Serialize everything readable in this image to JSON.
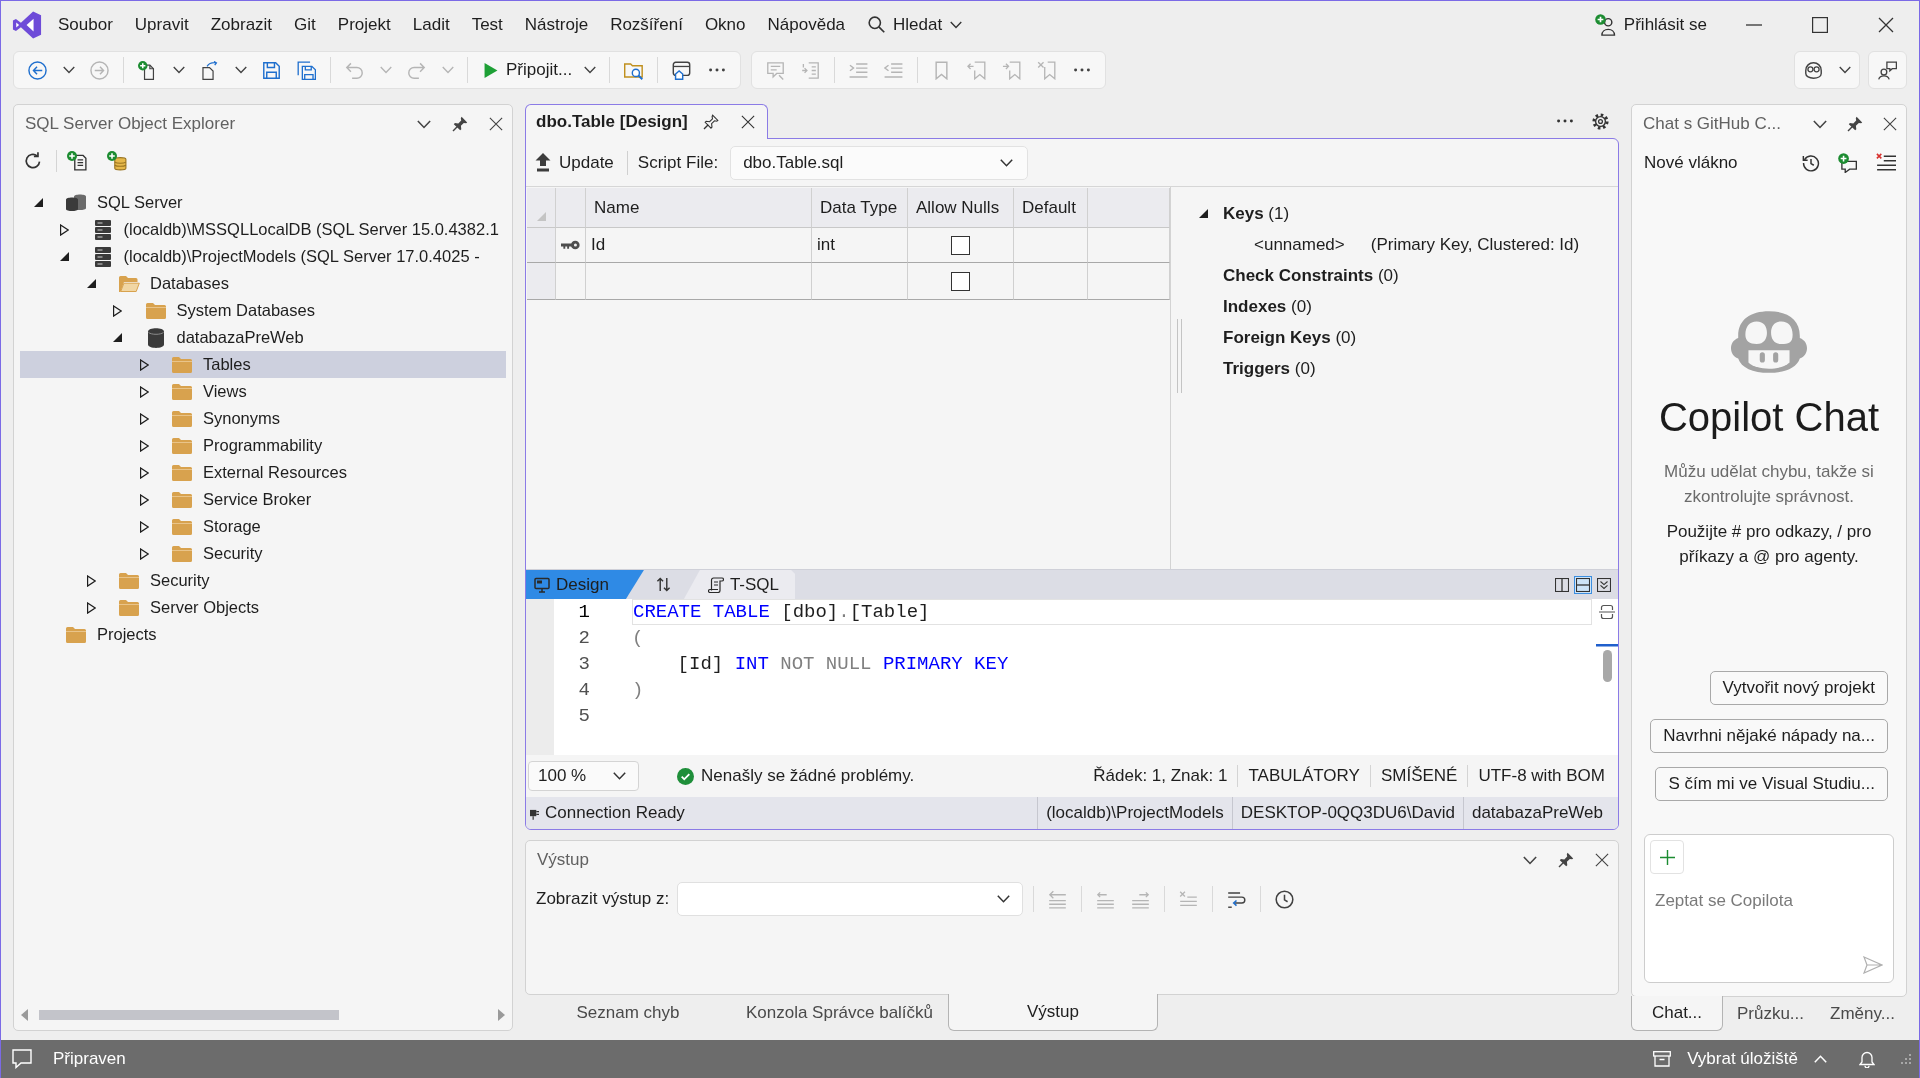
{
  "title_bar": {
    "menu": [
      {
        "label": "Soubor"
      },
      {
        "label": "Upravit"
      },
      {
        "label": "Zobrazit"
      },
      {
        "label": "Git"
      },
      {
        "label": "Projekt"
      },
      {
        "label": "Ladit"
      },
      {
        "label": "Test"
      },
      {
        "label": "Nástroje"
      },
      {
        "label": "Rozšíření"
      },
      {
        "label": "Okno"
      },
      {
        "label": "Nápověda"
      }
    ],
    "search": "Hledat",
    "sign_in": "Přihlásit se"
  },
  "toolbar": {
    "left": [
      [
        [
          {
            "kind": "back",
            "disabled": false
          },
          {
            "kind": "dropdown",
            "disabled": false
          },
          {
            "kind": "forward",
            "disabled": true
          }
        ],
        [
          {
            "kind": "new-item",
            "disabled": false
          },
          {
            "kind": "dropdown",
            "disabled": false
          },
          {
            "kind": "open-file",
            "disabled": false
          },
          {
            "kind": "dropdown",
            "disabled": false
          },
          {
            "kind": "save",
            "disabled": false
          },
          {
            "kind": "save-all",
            "disabled": false
          }
        ],
        [
          {
            "kind": "undo",
            "disabled": true
          },
          {
            "kind": "dropdown",
            "disabled": true
          },
          {
            "kind": "redo",
            "disabled": true
          },
          {
            "kind": "dropdown",
            "disabled": true
          }
        ],
        [
          {
            "kind": "start",
            "label": "Připojit...",
            "disabled": false
          },
          {
            "kind": "dropdown",
            "disabled": false
          }
        ],
        [
          {
            "kind": "find-in-files",
            "disabled": false
          }
        ],
        [
          {
            "kind": "browser",
            "disabled": false
          },
          {
            "kind": "more",
            "disabled": false
          }
        ]
      ],
      [
        [
          {
            "kind": "comment",
            "disabled": true
          },
          {
            "kind": "uncomment",
            "disabled": true
          }
        ],
        [
          {
            "kind": "indent",
            "disabled": true
          },
          {
            "kind": "outdent",
            "disabled": true
          }
        ],
        [
          {
            "kind": "bookmark",
            "disabled": true
          },
          {
            "kind": "bookmark-previous",
            "disabled": true
          },
          {
            "kind": "bookmark-next",
            "disabled": true
          },
          {
            "kind": "bookmark-clear",
            "disabled": true
          },
          {
            "kind": "more",
            "disabled": false
          }
        ]
      ]
    ],
    "right": [
      [
        [
          {
            "kind": "copilot",
            "disabled": false
          },
          {
            "kind": "dropdown",
            "disabled": false
          }
        ]
      ],
      [
        [
          {
            "kind": "feedback",
            "disabled": false
          }
        ]
      ]
    ]
  },
  "object_explorer": {
    "title": "SQL Server Object Explorer",
    "tree": [
      {
        "label": "SQL Server",
        "kind": "server-group",
        "expanded": true,
        "selected": false,
        "children": [
          {
            "label": "(localdb)\\MSSQLLocalDB (SQL Server 15.0.4382.1",
            "kind": "server",
            "expanded": false,
            "selected": false
          },
          {
            "label": "(localdb)\\ProjectModels (SQL Server 17.0.4025 -",
            "kind": "server",
            "expanded": true,
            "selected": false,
            "children": [
              {
                "label": "Databases",
                "kind": "folder-open",
                "expanded": true,
                "selected": false,
                "children": [
                  {
                    "label": "System Databases",
                    "kind": "folder",
                    "expanded": false,
                    "selected": false
                  },
                  {
                    "label": "databazaPreWeb",
                    "kind": "database",
                    "expanded": true,
                    "selected": false,
                    "children": [
                      {
                        "label": "Tables",
                        "kind": "folder",
                        "expanded": false,
                        "selected": true
                      },
                      {
                        "label": "Views",
                        "kind": "folder",
                        "expanded": false,
                        "selected": false
                      },
                      {
                        "label": "Synonyms",
                        "kind": "folder",
                        "expanded": false,
                        "selected": false
                      },
                      {
                        "label": "Programmability",
                        "kind": "folder",
                        "expanded": false,
                        "selected": false
                      },
                      {
                        "label": "External Resources",
                        "kind": "folder",
                        "expanded": false,
                        "selected": false
                      },
                      {
                        "label": "Service Broker",
                        "kind": "folder",
                        "expanded": false,
                        "selected": false
                      },
                      {
                        "label": "Storage",
                        "kind": "folder",
                        "expanded": false,
                        "selected": false
                      },
                      {
                        "label": "Security",
                        "kind": "folder",
                        "expanded": false,
                        "selected": false
                      }
                    ]
                  }
                ]
              },
              {
                "label": "Security",
                "kind": "folder",
                "expanded": false,
                "selected": false
              },
              {
                "label": "Server Objects",
                "kind": "folder",
                "expanded": false,
                "selected": false
              }
            ]
          }
        ]
      },
      {
        "label": "Projects",
        "kind": "folder",
        "selected": false
      }
    ]
  },
  "document": {
    "tabs": [
      {
        "title": "dbo.Table [Design]",
        "selected": true
      }
    ],
    "update": "Update",
    "script_file": {
      "label": "Script File:",
      "value": "dbo.Table.sql"
    },
    "grid": {
      "columns": [
        "Name",
        "Data Type",
        "Allow Nulls",
        "Default"
      ],
      "rows": [
        {
          "primary_key": true,
          "name": "Id",
          "data_type": "int",
          "allow_nulls": false
        },
        {
          "primary_key": false,
          "allow_nulls": false
        }
      ]
    },
    "properties": [
      {
        "text": "**Keys** (1)",
        "expanded": true,
        "children": [
          {
            "name": "<unnamed>",
            "detail": "(Primary Key, Clustered: Id)"
          }
        ]
      },
      {
        "text": "**Check Constraints** (0)"
      },
      {
        "text": "**Indexes** (0)"
      },
      {
        "text": "**Foreign Keys** (0)"
      },
      {
        "text": "**Triggers** (0)"
      }
    ],
    "view_tabs": [
      {
        "label": "Design",
        "kind": "design",
        "selected": true
      },
      {
        "label": "T-SQL",
        "kind": "script",
        "selected": false
      }
    ],
    "layout_buttons": [
      {
        "kind": "vertical",
        "selected": false
      },
      {
        "kind": "horizontal",
        "selected": true
      },
      {
        "kind": "collapse",
        "selected": false
      }
    ],
    "code": {
      "lines": [
        {
          "number": "1",
          "current": true,
          "tokens": [
            {
              "text": "CREATE TABLE",
              "kind": "keyword"
            },
            {
              "text": " [dbo]",
              "kind": "plain"
            },
            {
              "text": ".",
              "kind": "operator"
            },
            {
              "text": "[Table]",
              "kind": "plain"
            }
          ]
        },
        {
          "number": "2",
          "current": false,
          "tokens": [
            {
              "text": "(",
              "kind": "operator"
            }
          ]
        },
        {
          "number": "3",
          "current": false,
          "tokens": [
            {
              "text": "    [Id] ",
              "kind": "plain"
            },
            {
              "text": "INT",
              "kind": "keyword"
            },
            {
              "text": " NOT NULL ",
              "kind": "operator"
            },
            {
              "text": "PRIMARY KEY",
              "kind": "keyword"
            }
          ]
        },
        {
          "number": "4",
          "current": false,
          "tokens": [
            {
              "text": ")",
              "kind": "operator"
            }
          ]
        },
        {
          "number": "5",
          "current": false
        }
      ]
    },
    "zoom": "100 %",
    "issues": "Nenašly se žádné problémy.",
    "status": [
      "Řádek: 1, Znak: 1",
      "TABULÁTORY",
      "SMÍŠENÉ",
      "UTF-8 with BOM"
    ],
    "connection": {
      "status": "Connection Ready",
      "details": [
        "(localdb)\\ProjectModels",
        "DESKTOP-0QQ3DU6\\David",
        "databazaPreWeb"
      ]
    }
  },
  "output": {
    "title": "Výstup",
    "source_label": "Zobrazit výstup z:",
    "toolbar": [
      [
        {
          "kind": "find-message",
          "disabled": true
        }
      ],
      [
        {
          "kind": "previous-message",
          "disabled": true
        },
        {
          "kind": "next-message",
          "disabled": true
        }
      ],
      [
        {
          "kind": "clear-all",
          "disabled": true
        }
      ],
      [
        {
          "kind": "word-wrap",
          "disabled": false
        }
      ],
      [
        {
          "kind": "timestamps",
          "disabled": false
        }
      ]
    ],
    "tabs": [
      {
        "label": "Seznam chyb",
        "selected": false
      },
      {
        "label": "Konzola Správce balíčků",
        "selected": false
      },
      {
        "label": "Výstup",
        "selected": true
      }
    ]
  },
  "copilot_chat": {
    "title": "Chat s GitHub C...",
    "thread": "Nové vlákno",
    "heading": "Copilot Chat",
    "disclaimer": "Můžu udělat chybu, takže si zkontrolujte správnost.",
    "hint": "Použijte # pro odkazy, / pro příkazy a @ pro agenty.",
    "suggestions": [
      "Vytvořit nový projekt",
      "Navrhni nějaké nápady na...",
      "S čím mi ve Visual Studiu..."
    ],
    "input": {
      "placeholder": "Zeptat se Copilota"
    },
    "tabs": [
      {
        "label": "Chat...",
        "selected": true
      },
      {
        "label": "Průzku...",
        "selected": false
      },
      {
        "label": "Změny...",
        "selected": false
      }
    ]
  },
  "status_bar": {
    "text": "Připraven",
    "repository": "Vybrat úložiště"
  }
}
